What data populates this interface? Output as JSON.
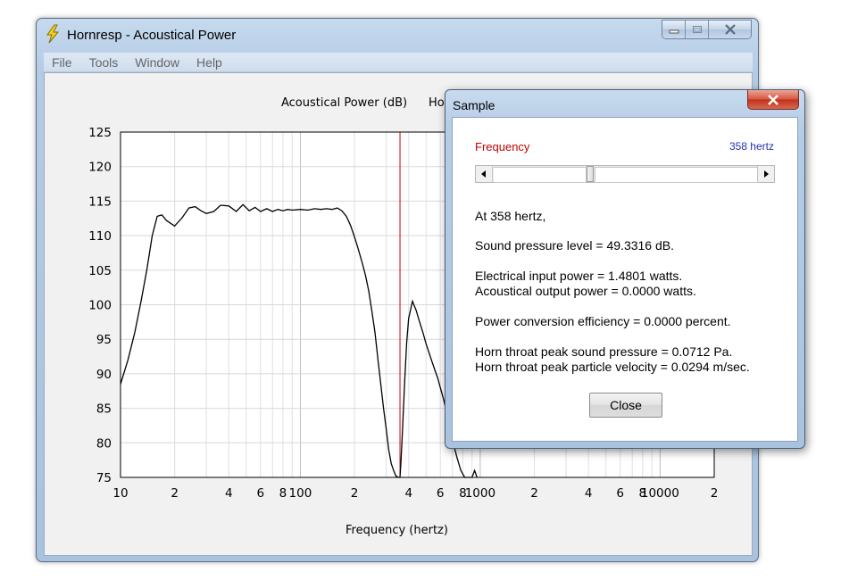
{
  "main_window": {
    "title": "Hornresp - Acoustical Power",
    "menu": [
      "File",
      "Tools",
      "Window",
      "Help"
    ]
  },
  "chart_data": {
    "type": "line",
    "title": "Acoustical Power (dB)",
    "title_partial": "Ho",
    "xlabel": "Frequency (hertz)",
    "ylabel": "",
    "x_scale": "log",
    "xlim": [
      10,
      20000
    ],
    "ylim": [
      75,
      125
    ],
    "y_ticks": [
      125,
      120,
      115,
      110,
      105,
      100,
      95,
      90,
      85,
      80,
      75
    ],
    "x_tick_labels": [
      {
        "value": 10,
        "label": "10"
      },
      {
        "value": 20,
        "label": "2"
      },
      {
        "value": 40,
        "label": "4"
      },
      {
        "value": 60,
        "label": "6"
      },
      {
        "value": 80,
        "label": "8"
      },
      {
        "value": 100,
        "label": "100"
      },
      {
        "value": 200,
        "label": "2"
      },
      {
        "value": 400,
        "label": "4"
      },
      {
        "value": 600,
        "label": "6"
      },
      {
        "value": 800,
        "label": "8"
      },
      {
        "value": 1000,
        "label": "1000"
      },
      {
        "value": 2000,
        "label": "2"
      },
      {
        "value": 4000,
        "label": "4"
      },
      {
        "value": 6000,
        "label": "6"
      },
      {
        "value": 8000,
        "label": "8"
      },
      {
        "value": 10000,
        "label": "10000"
      },
      {
        "value": 20000,
        "label": "2"
      }
    ],
    "grid": true,
    "marker_frequency": 358,
    "marker_color": "#cc0000",
    "series": [
      {
        "color": "#000000",
        "x": [
          10,
          11,
          12,
          13,
          14,
          15,
          16,
          17,
          18,
          20,
          22,
          24,
          26,
          28,
          30,
          33,
          36,
          40,
          44,
          48,
          52,
          56,
          60,
          65,
          70,
          75,
          80,
          85,
          90,
          100,
          110,
          120,
          130,
          140,
          150,
          160,
          170,
          180,
          190,
          200,
          210,
          220,
          230,
          240,
          250,
          260,
          270,
          280,
          290,
          300,
          310,
          320,
          330,
          340,
          350,
          355,
          358,
          362,
          370,
          380,
          390,
          400,
          420,
          440,
          460,
          480,
          500,
          520,
          540,
          560,
          580,
          600,
          630,
          660,
          700,
          740,
          780,
          820,
          860,
          900,
          930,
          960
        ],
        "y": [
          88.5,
          92,
          96,
          100.5,
          105,
          110,
          112.8,
          113,
          112.2,
          111.4,
          112.6,
          114,
          114.2,
          113.6,
          113.2,
          113.5,
          114.4,
          114.3,
          113.5,
          114.5,
          113.6,
          114.1,
          113.5,
          113.9,
          113.5,
          113.8,
          113.6,
          113.8,
          113.7,
          113.8,
          113.7,
          113.9,
          113.8,
          113.9,
          113.8,
          114.0,
          113.6,
          112.8,
          111.5,
          109.8,
          108.0,
          106.2,
          104.3,
          102.0,
          99.0,
          96.0,
          92.0,
          88.5,
          85.0,
          82.0,
          79.0,
          77.0,
          76.0,
          75.2,
          75.0,
          75.0,
          75.0,
          77.0,
          82.0,
          89.0,
          94.5,
          98.0,
          100.5,
          99.2,
          97.5,
          96.0,
          94.3,
          93.0,
          91.7,
          90.5,
          89.4,
          88.0,
          86.0,
          83.5,
          80.5,
          78.0,
          76.0,
          75.0,
          75.0,
          75.0,
          76.0,
          75.0
        ]
      }
    ]
  },
  "dialog": {
    "title": "Sample",
    "slider_label": "Frequency",
    "slider_value": "358 hertz",
    "slider_position": 0.38,
    "lines": [
      "At 358 hertz,",
      "Sound pressure level = 49.3316 dB.",
      "Electrical input power = 1.4801 watts.",
      "Acoustical output power = 0.0000 watts.",
      "Power conversion efficiency = 0.0000 percent.",
      "Horn throat peak sound pressure = 0.0712 Pa.",
      "Horn throat peak particle velocity = 0.0294 m/sec."
    ],
    "close_label": "Close"
  },
  "icons": {
    "app": "lightning-bolt-icon",
    "minimize": "minimize-icon",
    "maximize": "maximize-icon",
    "close": "close-icon"
  }
}
